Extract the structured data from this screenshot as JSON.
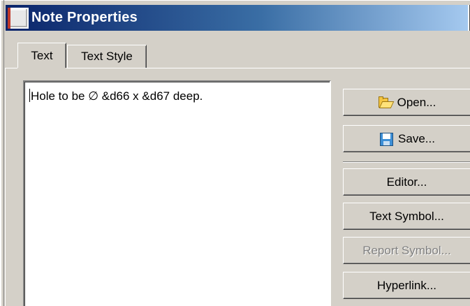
{
  "window": {
    "title": "Note Properties"
  },
  "tabs": [
    {
      "label": "Text",
      "active": true
    },
    {
      "label": "Text Style",
      "active": false
    }
  ],
  "text_area": {
    "value": "Hole to be ∅ &d66 x &d67 deep."
  },
  "buttons": {
    "open": {
      "label": "Open...",
      "icon": "folder-open-icon"
    },
    "save": {
      "label": "Save...",
      "icon": "floppy-disk-icon"
    },
    "editor": {
      "label": "Editor..."
    },
    "text_symbol": {
      "label": "Text Symbol..."
    },
    "report_symbol": {
      "label": "Report Symbol...",
      "disabled": true
    },
    "hyperlink": {
      "label": "Hyperlink..."
    }
  },
  "colors": {
    "title_bar_start": "#0a246a",
    "title_bar_end": "#a6caf0",
    "dialog_face": "#d4d0c8",
    "disabled_text": "#808080"
  }
}
